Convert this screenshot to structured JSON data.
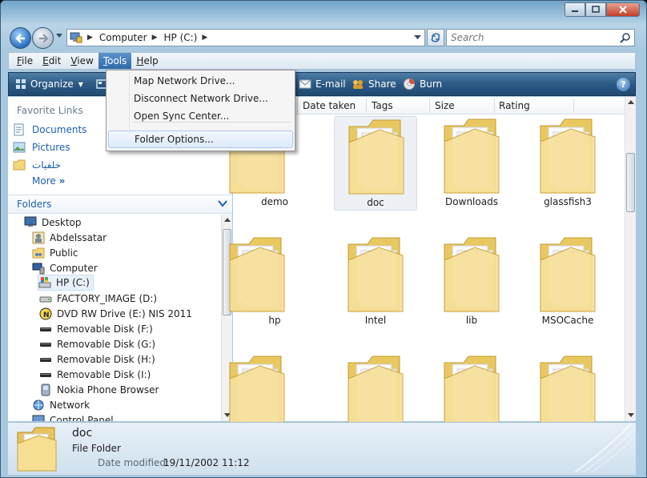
{
  "window": {
    "address": [
      "Computer",
      "HP (C:)"
    ],
    "search_placeholder": "Search"
  },
  "menubar": [
    {
      "label": "File",
      "u": "F",
      "rest": "ile"
    },
    {
      "label": "Edit",
      "u": "E",
      "rest": "dit"
    },
    {
      "label": "View",
      "u": "V",
      "rest": "iew"
    },
    {
      "label": "Tools",
      "u": "T",
      "rest": "ools"
    },
    {
      "label": "Help",
      "u": "H",
      "rest": "elp"
    }
  ],
  "tools_menu": {
    "items": [
      "Map Network Drive...",
      "Disconnect Network Drive...",
      "Open Sync Center...",
      "Folder Options..."
    ],
    "highlighted": "Folder Options..."
  },
  "commandbar": {
    "organize": "Organize",
    "email": "E-mail",
    "share": "Share",
    "burn": "Burn"
  },
  "navpane": {
    "favorites_title": "Favorite Links",
    "favorites": [
      "Documents",
      "Pictures",
      "خلفيات"
    ],
    "more": "More",
    "folders_title": "Folders",
    "tree": [
      "Desktop",
      "Abdelssatar",
      "Public",
      "Computer",
      "HP (C:)",
      "FACTORY_IMAGE (D:)",
      "DVD RW Drive (E:) NIS 2011",
      "Removable Disk (F:)",
      "Removable Disk (G:)",
      "Removable Disk (H:)",
      "Removable Disk (I:)",
      "Nokia Phone Browser",
      "Network",
      "Control Panel"
    ]
  },
  "columns": [
    "Date taken",
    "Tags",
    "Size",
    "Rating"
  ],
  "files": [
    "demo",
    "doc",
    "Downloads",
    "glassfish3",
    "hp",
    "Intel",
    "lib",
    "MSOCache",
    "",
    "",
    "",
    ""
  ],
  "details": {
    "name": "doc",
    "type": "File Folder",
    "modified_label": "Date modified:",
    "modified_value": "19/11/2002 11:12"
  },
  "colors": {
    "menu_highlight": "#3f7bb9",
    "command_bar": "#2c5a84",
    "link_blue": "#1a5fb0",
    "folder_yellow": "#f5d77a"
  }
}
